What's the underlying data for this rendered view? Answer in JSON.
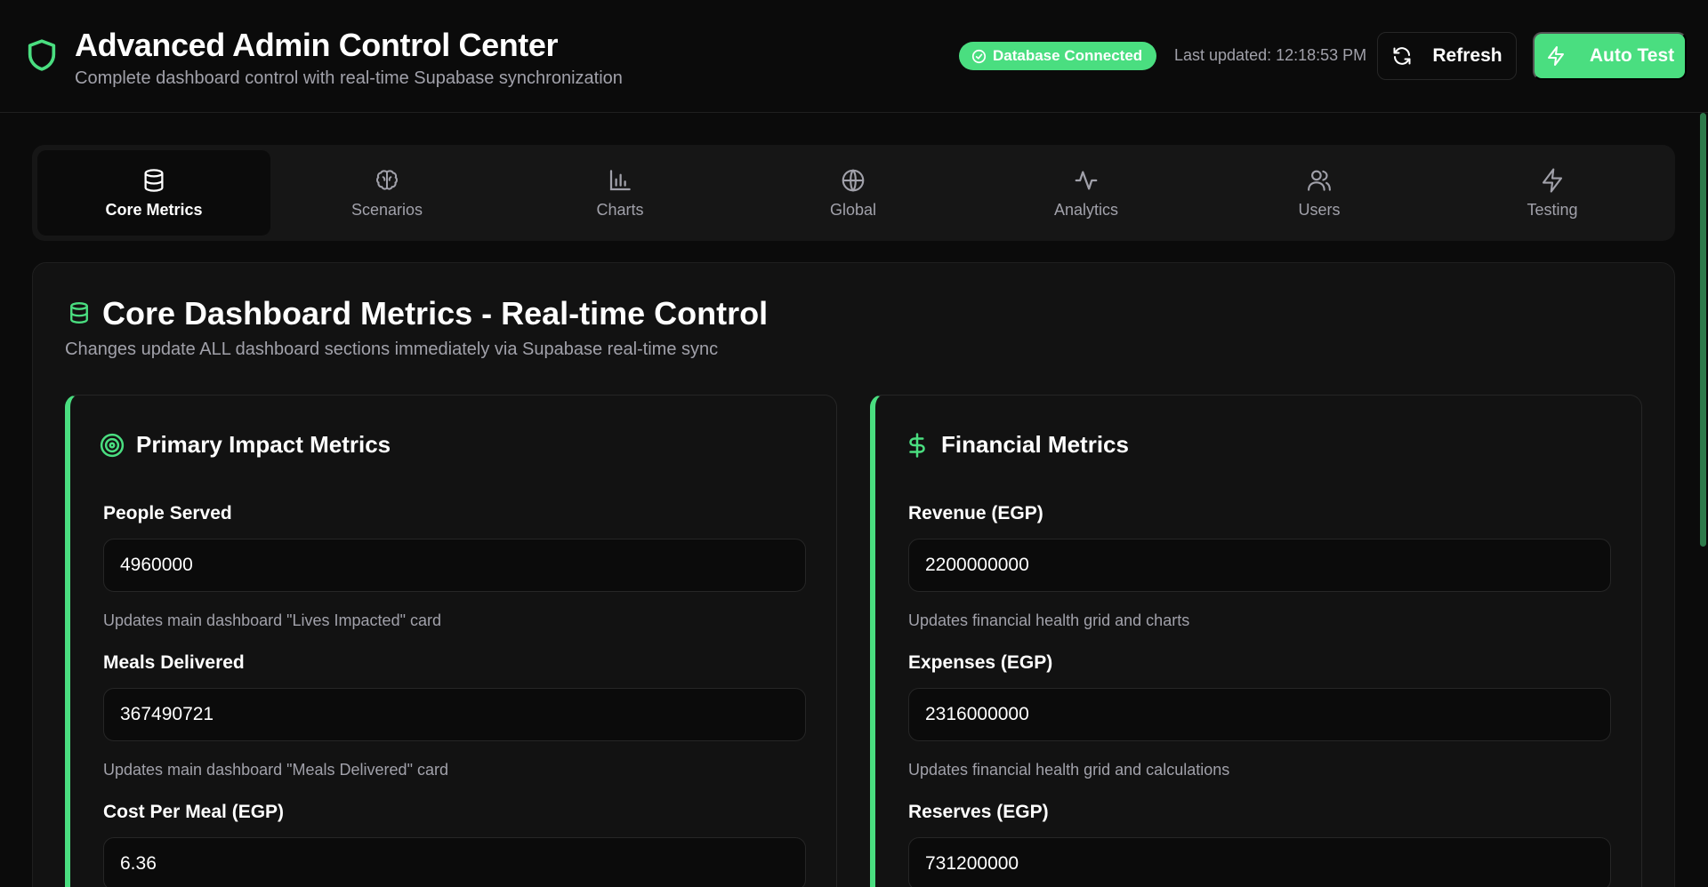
{
  "header": {
    "title": "Advanced Admin Control Center",
    "subtitle": "Complete dashboard control with real-time Supabase synchronization",
    "status_badge": "Database Connected",
    "last_updated": "Last updated: 12:18:53 PM",
    "refresh_label": "Refresh",
    "auto_test_label": "Auto Test"
  },
  "tabs": [
    {
      "label": "Core Metrics",
      "icon": "database-icon",
      "active": true
    },
    {
      "label": "Scenarios",
      "icon": "brain-icon",
      "active": false
    },
    {
      "label": "Charts",
      "icon": "bar-chart-icon",
      "active": false
    },
    {
      "label": "Global",
      "icon": "globe-icon",
      "active": false
    },
    {
      "label": "Analytics",
      "icon": "activity-icon",
      "active": false
    },
    {
      "label": "Users",
      "icon": "users-icon",
      "active": false
    },
    {
      "label": "Testing",
      "icon": "zap-icon",
      "active": false
    }
  ],
  "panel": {
    "title": "Core Dashboard Metrics - Real-time Control",
    "subtitle": "Changes update ALL dashboard sections immediately via Supabase real-time sync"
  },
  "primary": {
    "title": "Primary Impact Metrics",
    "icon": "target-icon",
    "fields": [
      {
        "label": "People Served",
        "value": "4960000",
        "help": "Updates main dashboard \"Lives Impacted\" card"
      },
      {
        "label": "Meals Delivered",
        "value": "367490721",
        "help": "Updates main dashboard \"Meals Delivered\" card"
      },
      {
        "label": "Cost Per Meal (EGP)",
        "value": "6.36",
        "help": ""
      }
    ]
  },
  "financial": {
    "title": "Financial Metrics",
    "icon": "dollar-icon",
    "fields": [
      {
        "label": "Revenue (EGP)",
        "value": "2200000000",
        "help": "Updates financial health grid and charts"
      },
      {
        "label": "Expenses (EGP)",
        "value": "2316000000",
        "help": "Updates financial health grid and calculations"
      },
      {
        "label": "Reserves (EGP)",
        "value": "731200000",
        "help": ""
      }
    ]
  },
  "colors": {
    "accent": "#4ade80",
    "background": "#0b0b0b",
    "panel": "#121212",
    "muted_text": "#a1a1aa"
  }
}
